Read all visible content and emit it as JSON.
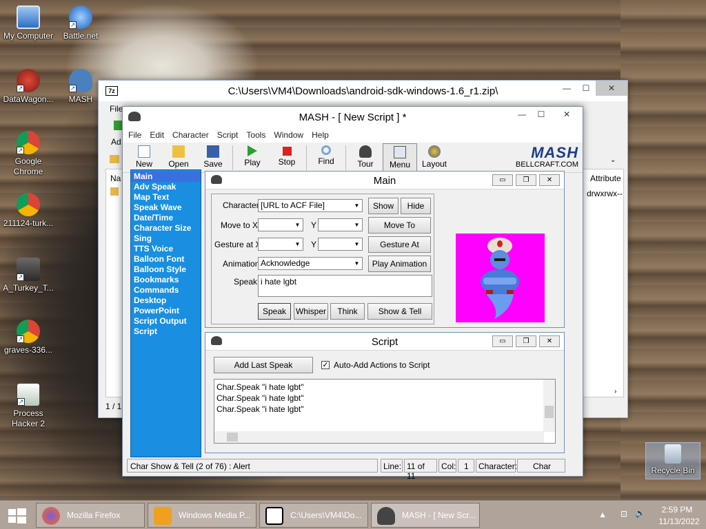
{
  "desktop": {
    "icons": [
      {
        "label": "My Computer"
      },
      {
        "label": "Battle.net"
      },
      {
        "label": "DataWagon..."
      },
      {
        "label": "MASH"
      },
      {
        "label": "Google Chrome"
      },
      {
        "label": "211124-turk..."
      },
      {
        "label": "A_Turkey_T..."
      },
      {
        "label": "graves-336..."
      },
      {
        "label": "Process Hacker 2"
      },
      {
        "label": "Recycle Bin"
      }
    ]
  },
  "zip_window": {
    "title": "C:\\Users\\VM4\\Downloads\\android-sdk-windows-1.6_r1.zip\\",
    "menu_partial": "File",
    "add_label": "Ad",
    "name_header": "Na",
    "attr_header": "Attribute",
    "attr_value": "drwxrwx--",
    "status": "1 / 1"
  },
  "mash": {
    "title": "MASH - [ New Script ] *",
    "menu": [
      "File",
      "Edit",
      "Character",
      "Script",
      "Tools",
      "Window",
      "Help"
    ],
    "toolbar": [
      {
        "label": "New"
      },
      {
        "label": "Open"
      },
      {
        "label": "Save"
      },
      {
        "label": "Play"
      },
      {
        "label": "Stop"
      },
      {
        "label": "Find"
      },
      {
        "label": "Tour"
      },
      {
        "label": "Menu"
      },
      {
        "label": "Layout"
      }
    ],
    "logo": {
      "text": "MASH",
      "sub": "BELLCRAFT.COM"
    },
    "nav": [
      "Main",
      "Adv Speak",
      "Map Text",
      "Speak Wave",
      "Date/Time",
      "Character Size",
      "Sing",
      "TTS Voice",
      "Balloon Font",
      "Balloon Style",
      "Bookmarks",
      "Commands",
      "Desktop",
      "PowerPoint",
      "Script Output",
      "Script"
    ],
    "main_panel": {
      "title": "Main",
      "character_label": "Character",
      "character_value": "[URL to ACF File]",
      "show": "Show",
      "hide": "Hide",
      "moveto_label": "Move to X",
      "y_label": "Y",
      "moveto_btn": "Move To",
      "gesture_label": "Gesture at X",
      "gesture_btn": "Gesture At",
      "animation_label": "Animation",
      "animation_value": "Acknowledge",
      "play_animation": "Play Animation",
      "speak_label": "Speak",
      "speak_value": "i hate lgbt",
      "speak_btn": "Speak",
      "whisper_btn": "Whisper",
      "think_btn": "Think",
      "show_tell_btn": "Show & Tell"
    },
    "script_panel": {
      "title": "Script",
      "add_last": "Add Last Speak",
      "auto_add": "Auto-Add Actions to Script",
      "auto_add_checked": true,
      "lines": [
        "Char.Speak \"i hate lgbt\"",
        "Char.Speak \"i hate lgbt\"",
        "Char.Speak \"i hate lgbt\""
      ]
    },
    "status": {
      "left": "Char Show & Tell (2 of 76) : Alert",
      "line_label": "Line:",
      "line_value": "11 of 11",
      "col_label": "Col:",
      "col_value": "1",
      "char_label": "Character:",
      "char_value": "Char"
    }
  },
  "taskbar": {
    "tasks": [
      {
        "label": "Mozilla Firefox"
      },
      {
        "label": "Windows Media P..."
      },
      {
        "label": "C:\\Users\\VM4\\Do..."
      },
      {
        "label": "MASH - [ New Scr..."
      }
    ],
    "time": "2:59 PM",
    "date": "11/13/2022"
  },
  "colors": {
    "nav_bg": "#1a8ee0",
    "genie_bg": "#ff00ff",
    "taskbar": "#b0a49a"
  }
}
